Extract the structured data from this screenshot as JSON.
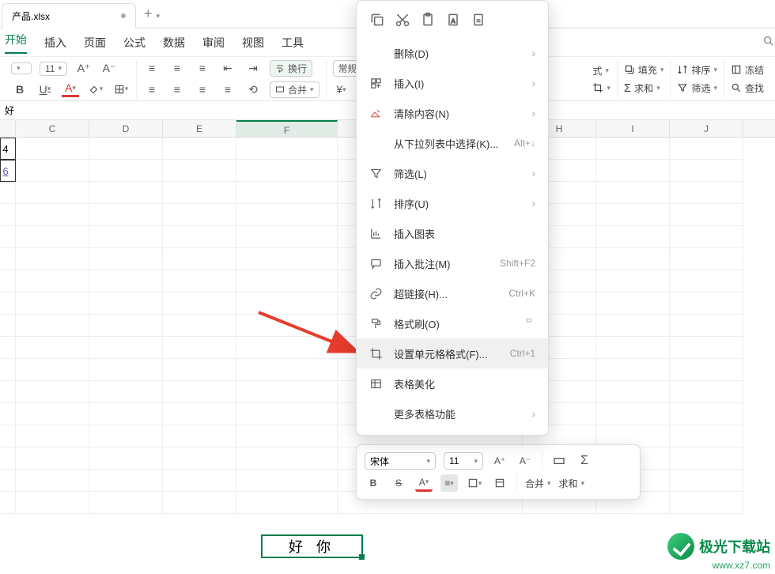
{
  "tab": {
    "filename": "产品.xlsx"
  },
  "menu": {
    "start": "开始",
    "insert": "插入",
    "page": "页面",
    "formula": "公式",
    "data": "数据",
    "review": "审阅",
    "view": "视图",
    "tools": "工具"
  },
  "toolbar": {
    "fontsize": "11",
    "wrap": "换行",
    "merge": "合并",
    "general": "常规",
    "style": "式",
    "fill": "填充",
    "sort": "排序",
    "freeze": "冻结",
    "sum": "求和",
    "filter": "筛选",
    "find": "查找"
  },
  "fx": {
    "value": "好"
  },
  "columns": [
    "C",
    "D",
    "E",
    "F",
    "H",
    "I",
    "J"
  ],
  "cells": {
    "a1": "4",
    "a2": "6",
    "inline": "好 你"
  },
  "context": {
    "delete": "删除(D)",
    "insert": "插入(I)",
    "clear": "清除内容(N)",
    "dropdown": "从下拉列表中选择(K)...",
    "dropdown_sc": "Alt+↓",
    "filter": "筛选(L)",
    "sort": "排序(U)",
    "chart": "插入图表",
    "comment": "插入批注(M)",
    "comment_sc": "Shift+F2",
    "link": "超链接(H)...",
    "link_sc": "Ctrl+K",
    "painter": "格式刷(O)",
    "cellformat": "设置单元格格式(F)...",
    "cellformat_sc": "Ctrl+1",
    "beautify": "表格美化",
    "more": "更多表格功能"
  },
  "mini": {
    "font": "宋体",
    "size": "11",
    "merge": "合并",
    "sum": "求和",
    "bold": "B",
    "strike": "S"
  },
  "watermark": {
    "line1": "极光下载站",
    "line2": "www.xz7.com"
  }
}
